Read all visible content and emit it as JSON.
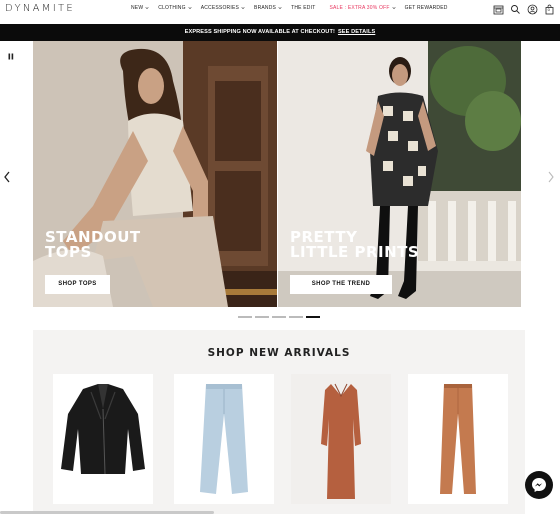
{
  "brand": {
    "logo": "DYNAMITE"
  },
  "nav": {
    "items": [
      {
        "label": "NEW",
        "dropdown": true
      },
      {
        "label": "CLOTHING",
        "dropdown": true
      },
      {
        "label": "ACCESSORIES",
        "dropdown": true
      },
      {
        "label": "BRANDS",
        "dropdown": true
      },
      {
        "label": "THE EDIT",
        "dropdown": false
      },
      {
        "label": "SALE : EXTRA 30% OFF",
        "dropdown": true,
        "color": "#e8365f"
      },
      {
        "label": "GET REWARDED",
        "dropdown": false
      }
    ],
    "icons": [
      "store-icon",
      "search-icon",
      "account-icon",
      "bag-icon"
    ],
    "bag_count": "0"
  },
  "promo": {
    "text": "EXPRESS SHIPPING NOW AVAILABLE AT CHECKOUT!",
    "link": "SEE DETAILS"
  },
  "hero": {
    "panels": [
      {
        "title_line1": "STANDOUT",
        "title_line2": "TOPS",
        "cta": "SHOP TOPS"
      },
      {
        "title_line1": "PRETTY",
        "title_line2": "LITTLE PRINTS",
        "cta": "SHOP THE TREND"
      }
    ],
    "slides_total": 5,
    "active_slide": 5
  },
  "arrivals": {
    "title": "SHOP NEW ARRIVALS",
    "products": [
      {
        "name": "black leather moto jacket",
        "color": "#1a1a1a"
      },
      {
        "name": "light wash wide leg jeans",
        "color": "#b9cfe0"
      },
      {
        "name": "rust knit midi dress",
        "color": "#b5603f"
      },
      {
        "name": "cognac faux leather pants",
        "color": "#c47a4f"
      }
    ]
  },
  "colors": {
    "accent_sale": "#e8365f",
    "promo_bg": "#0b0b0b"
  }
}
